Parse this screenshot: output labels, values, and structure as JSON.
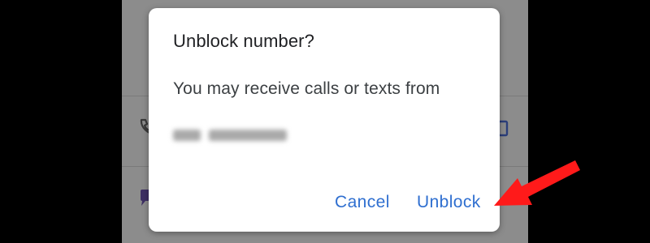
{
  "dialog": {
    "title": "Unblock number?",
    "message": "You may receive calls or texts from",
    "cancel_label": "Cancel",
    "unblock_label": "Unblock"
  },
  "icons": {
    "background_call": "phone-call-icon",
    "background_message": "message-icon",
    "background_right": "square-icon",
    "annotation": "red-arrow-icon"
  },
  "colors": {
    "accent": "#2f6fd0",
    "annotation_arrow": "#ff1a1a",
    "scrim": "#8c8c8c",
    "dialog_bg": "#ffffff"
  }
}
